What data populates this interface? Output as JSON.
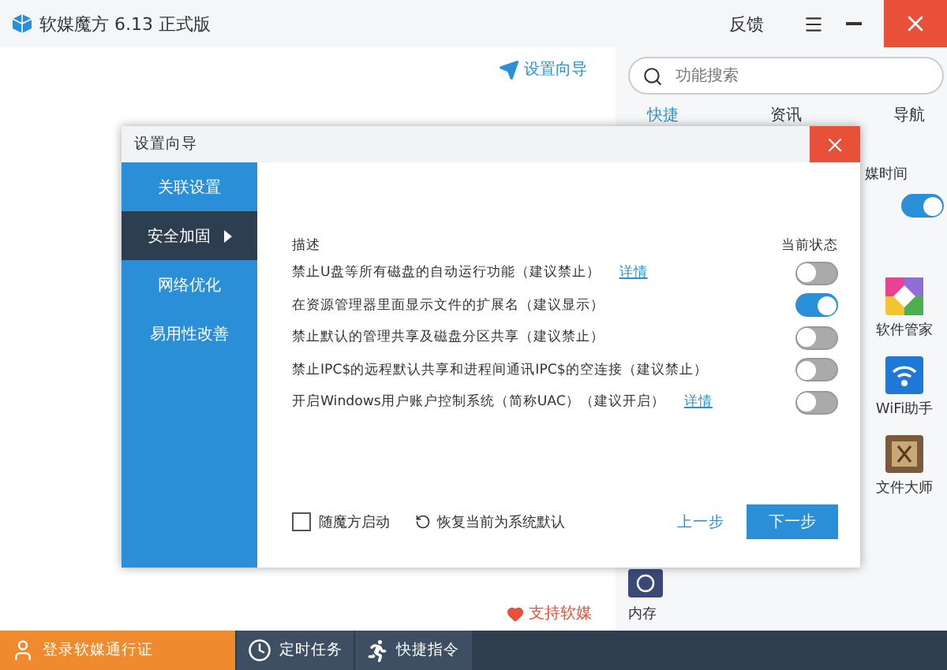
{
  "window": {
    "title": "软媒魔方 6.13 正式版",
    "feedback": "反馈"
  },
  "main": {
    "wizard_link": "设置向导",
    "support_link": "支持软媒"
  },
  "right_panel": {
    "search": {
      "placeholder": "功能搜索"
    },
    "tabs": [
      {
        "label": "快捷",
        "selected": true
      },
      {
        "label": "资讯",
        "selected": false
      },
      {
        "label": "导航",
        "selected": false
      }
    ],
    "time_widget": {
      "label": "媒时间",
      "on": true
    },
    "tools": [
      {
        "label": "软件管家",
        "kind": "apps"
      },
      {
        "label": "WiFi助手",
        "kind": "wifi"
      },
      {
        "label": "文件大师",
        "kind": "files"
      }
    ],
    "bottom_tool": {
      "label": "内存"
    }
  },
  "dialog": {
    "title": "设置向导",
    "nav": [
      {
        "label": "关联设置",
        "selected": false
      },
      {
        "label": "安全加固",
        "selected": true
      },
      {
        "label": "网络优化",
        "selected": false
      },
      {
        "label": "易用性改善",
        "selected": false
      }
    ],
    "columns": [
      "描述",
      "当前状态"
    ],
    "rows": [
      {
        "text": "禁止U盘等所有磁盘的自动运行功能（建议禁止）",
        "link": "详情",
        "on": false
      },
      {
        "text": "在资源管理器里面显示文件的扩展名（建议显示）",
        "on": true
      },
      {
        "text": "禁止默认的管理共享及磁盘分区共享（建议禁止）",
        "on": false
      },
      {
        "text": "禁止IPC$的远程默认共享和进程间通讯IPC$的空连接（建议禁止）",
        "on": false
      },
      {
        "text": "开启Windows用户账户控制系统（简称UAC）（建议开启）",
        "link": "详情",
        "on": false
      }
    ],
    "startup": {
      "label": "随魔方启动",
      "checked": false
    },
    "restore": "恢复当前为系统默认",
    "prev": "上一步",
    "next": "下一步"
  },
  "bottom_bar": [
    {
      "label": "登录软媒通行证",
      "kind": "login"
    },
    {
      "label": "定时任务",
      "kind": "timer"
    },
    {
      "label": "快捷指令",
      "kind": "command"
    }
  ]
}
